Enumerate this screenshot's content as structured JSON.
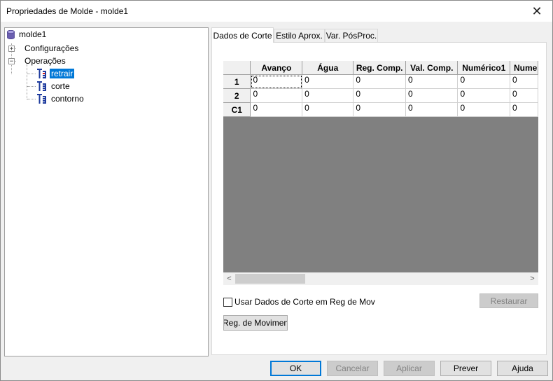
{
  "window": {
    "title": "Propriedades de Molde - molde1",
    "close_glyph": "✕"
  },
  "tree": {
    "root": "molde1",
    "configuracoes": "Configurações",
    "operacoes": "Operações",
    "ops": [
      "retrair",
      "corte",
      "contorno"
    ],
    "selected": "retrair"
  },
  "tabs": [
    "Dados de Corte",
    "Estilo Aprox.",
    "Var. PósProc."
  ],
  "grid": {
    "columns": [
      "Avanço",
      "Água",
      "Reg. Comp.",
      "Val. Comp.",
      "Numérico1",
      "Nume"
    ],
    "rows": [
      {
        "label": "1",
        "cells": [
          "0",
          "0",
          "0",
          "0",
          "0",
          "0"
        ]
      },
      {
        "label": "2",
        "cells": [
          "0",
          "0",
          "0",
          "0",
          "0",
          "0"
        ]
      },
      {
        "label": "C1",
        "cells": [
          "0",
          "0",
          "0",
          "0",
          "0",
          "0"
        ]
      }
    ]
  },
  "scroll": {
    "left": "<",
    "right": ">"
  },
  "options": {
    "use_cut_data_label": "Usar Dados de Corte em Reg de Mov",
    "use_cut_data_checked": false,
    "restore_label": "Restaurar",
    "reg_mov_label": "Reg. de Movimento"
  },
  "footer": {
    "ok": "OK",
    "cancel": "Cancelar",
    "apply": "Aplicar",
    "preview": "Prever",
    "help": "Ajuda"
  },
  "colors": {
    "selection": "#0078d7",
    "op_icon": "#1f3c9e",
    "op_icon_accent": "#d02020",
    "db_icon": "#6b5fb0"
  }
}
